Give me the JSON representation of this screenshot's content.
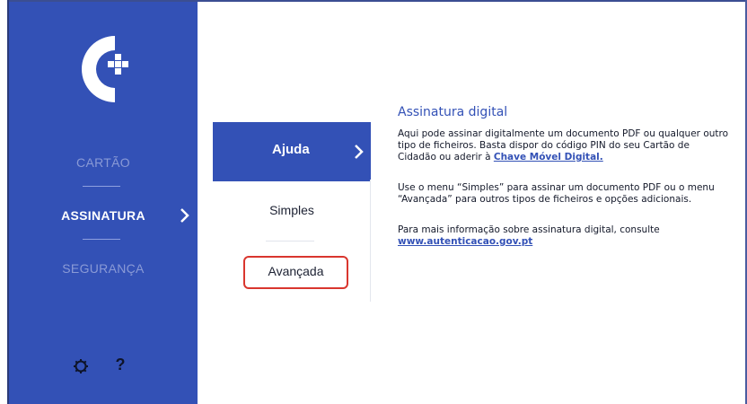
{
  "colors": {
    "primary": "#3351b6",
    "sidebar_muted_text": "#8a9ad6",
    "highlight_border": "#d9362e"
  },
  "logo": {
    "icon": "cartao-de-cidadao-logo"
  },
  "sidebar": {
    "items": [
      {
        "label": "CARTÃO",
        "active": false
      },
      {
        "label": "ASSINATURA",
        "active": true
      },
      {
        "label": "SEGURANÇA",
        "active": false
      }
    ],
    "bottom_icons": [
      "gear-icon",
      "help-icon"
    ],
    "help_glyph": "?"
  },
  "submenu": {
    "items": [
      {
        "label": "Ajuda",
        "active": true
      },
      {
        "label": "Simples",
        "active": false
      },
      {
        "label": "Avançada",
        "active": false,
        "highlighted": true
      }
    ]
  },
  "content": {
    "title": "Assinatura digital",
    "p1_text": "Aqui pode assinar digitalmente um documento PDF ou qualquer outro tipo de ficheiros. Basta dispor do código PIN do seu Cartão de Cidadão ou aderir à ",
    "p1_link": "Chave Móvel Digital.",
    "p2_text": "Use o menu “Simples” para assinar um documento PDF ou o menu “Avançada” para outros tipos de ficheiros e opções adicionais.",
    "p3_text": "Para mais informação sobre assinatura digital, consulte ",
    "p3_link": "www.autenticacao.gov.pt"
  }
}
